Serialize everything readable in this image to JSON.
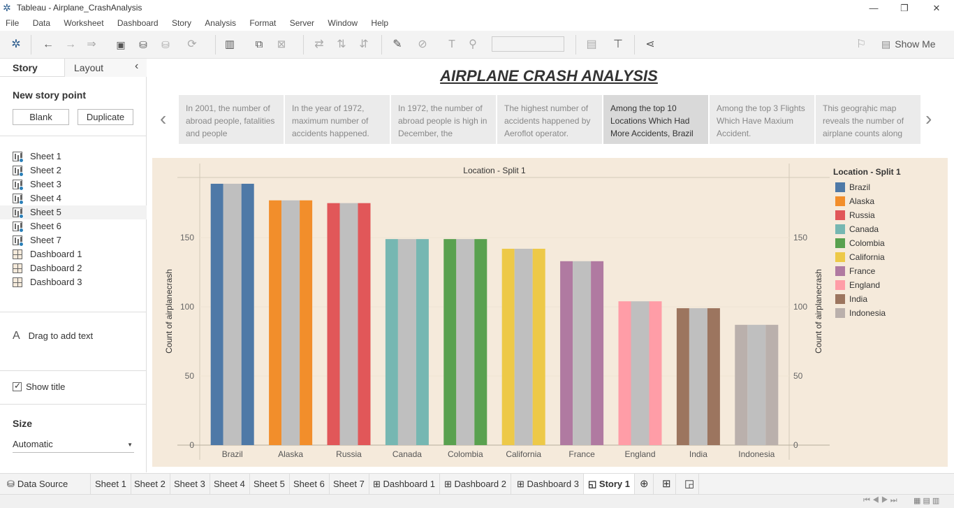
{
  "window": {
    "title": "Tableau - Airplane_CrashAnalysis",
    "controls": {
      "minimize": "—",
      "restore": "❐",
      "close": "✕"
    }
  },
  "menu": [
    "File",
    "Data",
    "Worksheet",
    "Dashboard",
    "Story",
    "Analysis",
    "Format",
    "Server",
    "Window",
    "Help"
  ],
  "toolbar": {
    "show_me": "Show Me"
  },
  "left_panel": {
    "tabs": {
      "story": "Story",
      "layout": "Layout"
    },
    "collapse_icon": "‹",
    "new_story_point": "New story point",
    "blank_button": "Blank",
    "duplicate_button": "Duplicate",
    "sheets": [
      {
        "label": "Sheet 1",
        "kind": "sheet"
      },
      {
        "label": "Sheet 2",
        "kind": "sheet"
      },
      {
        "label": "Sheet 3",
        "kind": "sheet"
      },
      {
        "label": "Sheet 4",
        "kind": "sheet"
      },
      {
        "label": "Sheet 5",
        "kind": "sheet"
      },
      {
        "label": "Sheet 6",
        "kind": "sheet"
      },
      {
        "label": "Sheet 7",
        "kind": "sheet"
      },
      {
        "label": "Dashboard 1",
        "kind": "dashboard"
      },
      {
        "label": "Dashboard 2",
        "kind": "dashboard"
      },
      {
        "label": "Dashboard 3",
        "kind": "dashboard"
      }
    ],
    "drag_text": "Drag to add text",
    "drag_icon": "A",
    "show_title": "Show title",
    "size_header": "Size",
    "size_value": "Automatic"
  },
  "story": {
    "title": "AIRPLANE CRASH ANALYSIS",
    "points": [
      "In 2001, the number of abroad people, fatalities and people",
      "In the year of 1972, maximum number of accidents happened.",
      "In 1972, the number of abroad people is high in  December, the",
      "The highest number of accidents happened by Aeroflot operator.",
      "Among the top 10 Locations Which Had More Accidents, Brazil",
      "Among the top 3 Flights Which Have Maxium Accident.",
      "This geogrąhic map reveals the number of airplane counts along"
    ],
    "active_point": 4,
    "prev_arrow": "‹",
    "next_arrow": "›"
  },
  "chart_data": {
    "type": "bar",
    "title": "Location - Split 1",
    "ylabel": "Count of airplanecrash",
    "ylabel_right": "Count of airplanecrash",
    "ylim": [
      0,
      190
    ],
    "yticks": [
      0,
      50,
      100,
      150
    ],
    "categories": [
      "Brazil",
      "Alaska",
      "Russia",
      "Canada",
      "Colombia",
      "California",
      "France",
      "England",
      "India",
      "Indonesia"
    ],
    "values": [
      189,
      177,
      175,
      149,
      149,
      142,
      133,
      104,
      99,
      87
    ],
    "colors": [
      "#4e79a7",
      "#f28e2b",
      "#e15759",
      "#76b7b2",
      "#59a14f",
      "#edc948",
      "#b07aa1",
      "#ff9da7",
      "#9c755f",
      "#bab0ac"
    ],
    "inner_bar_color": "#bfbfbf",
    "legend_title": "Location - Split 1",
    "legend_position": "right",
    "grid": true
  },
  "bottom_tabs": {
    "data_source": "Data Source",
    "tabs": [
      "Sheet 1",
      "Sheet 2",
      "Sheet 3",
      "Sheet 4",
      "Sheet 5",
      "Sheet 6",
      "Sheet 7",
      "Dashboard 1",
      "Dashboard 2",
      "Dashboard 3",
      "Story 1"
    ],
    "active": "Story 1"
  }
}
